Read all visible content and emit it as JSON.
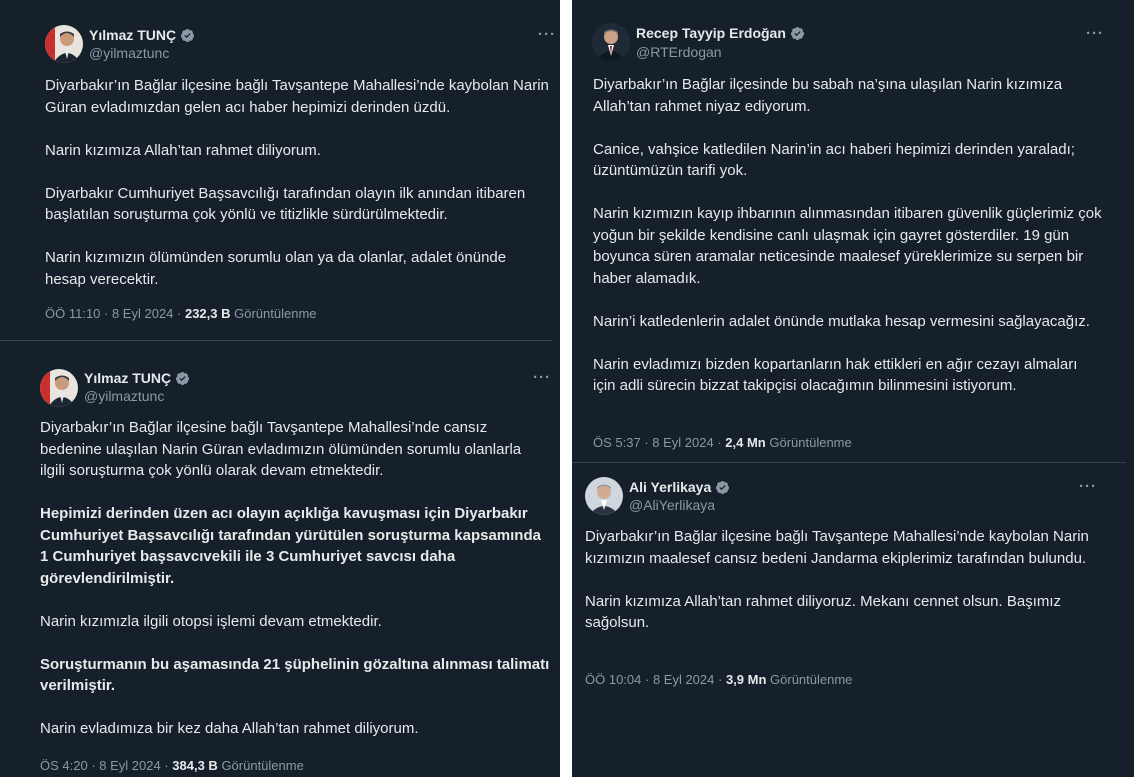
{
  "left_column": {
    "tweet1": {
      "author_name": "Yılmaz TUNÇ",
      "handle": "@yilmaztunc",
      "more_label": "···",
      "paragraphs": [
        "Diyarbakır’ın Bağlar ilçesine bağlı Tavşantepe Mahallesi’nde kaybolan Narin Güran evladımızdan gelen acı haber hepimizi derinden üzdü.",
        "Narin kızımıza Allah’tan rahmet diliyorum.",
        "Diyarbakır Cumhuriyet Başsavcılığı tarafından olayın ilk anından itibaren başlatılan soruşturma çok yönlü ve titizlikle sürdürülmektedir.",
        "Narin kızımızın ölümünden sorumlu olan ya da olanlar, adalet önünde hesap verecektir."
      ],
      "time": "ÖÖ 11:10",
      "date": "8 Eyl 2024",
      "views": "232,3 B",
      "views_label": "Görüntülenme"
    },
    "tweet2": {
      "author_name": "Yılmaz TUNÇ",
      "handle": "@yilmaztunc",
      "more_label": "···",
      "paragraphs": [
        "Diyarbakır’ın Bağlar ilçesine bağlı Tavşantepe Mahallesi’nde cansız bedenine ulaşılan Narin Güran evladımızın ölümünden sorumlu olanlarla ilgili soruşturma çok yönlü olarak devam etmektedir.",
        "Hepimizi derinden üzen acı olayın açıklığa kavuşması için Diyarbakır Cumhuriyet Başsavcılığı tarafından yürütülen soruşturma kapsamında 1 Cumhuriyet başsavcıvekili ile 3 Cumhuriyet savcısı daha görevlendirilmiştir.",
        "Narin kızımızla ilgili otopsi işlemi devam etmektedir.",
        "Soruşturmanın bu aşamasında 21 şüphelinin gözaltına alınması talimatı verilmiştir.",
        "Narin evladımıza bir kez daha Allah’tan rahmet diliyorum."
      ],
      "time": "ÖS 4:20",
      "date": "8 Eyl 2024",
      "views": "384,3 B",
      "views_label": "Görüntülenme"
    }
  },
  "right_column": {
    "tweet1": {
      "author_name": "Recep Tayyip Erdoğan",
      "handle": "@RTErdogan",
      "more_label": "···",
      "paragraphs": [
        "Diyarbakır’ın Bağlar ilçesinde bu sabah na’şına ulaşılan Narin kızımıza Allah’tan rahmet niyaz ediyorum.",
        "Canice, vahşice katledilen Narin’in acı haberi hepimizi derinden yaraladı; üzüntümüzün tarifi yok.",
        "Narin kızımızın kayıp ihbarının alınmasından itibaren güvenlik güçlerimiz çok yoğun bir şekilde kendisine canlı ulaşmak için gayret gösterdiler. 19 gün boyunca süren aramalar neticesinde maalesef yüreklerimize su serpen bir haber alamadık.",
        "Narin’i katledenlerin adalet önünde mutlaka hesap vermesini sağlayacağız.",
        "Narin evladımızı bizden kopartanların hak ettikleri en ağır cezayı almaları için adli sürecin bizzat takipçisi olacağımın bilinmesini istiyorum."
      ],
      "time": "ÖS 5:37",
      "date": "8 Eyl 2024",
      "views": "2,4 Mn",
      "views_label": "Görüntülenme"
    },
    "tweet2": {
      "author_name": "Ali Yerlikaya",
      "handle": "@AliYerlikaya",
      "more_label": "···",
      "paragraphs": [
        "Diyarbakır’ın Bağlar ilçesine bağlı Tavşantepe Mahallesi’nde kaybolan Narin kızımızın maalesef cansız bedeni Jandarma ekiplerimiz tarafından bulundu.",
        "Narin kızımıza Allah’tan rahmet diliyoruz. Mekanı cennet olsun. Başımız sağolsun."
      ],
      "time": "ÖÖ 10:04",
      "date": "8 Eyl 2024",
      "views": "3,9 Mn",
      "views_label": "Görüntülenme"
    }
  },
  "icons": {
    "verified_badge": "verified-badge-icon",
    "more": "more-icon"
  },
  "colors": {
    "background": "#15202b",
    "text": "#e7e9ea",
    "secondary_text": "#8b98a5",
    "divider": "#38444d",
    "verified": "#8b98a5"
  }
}
